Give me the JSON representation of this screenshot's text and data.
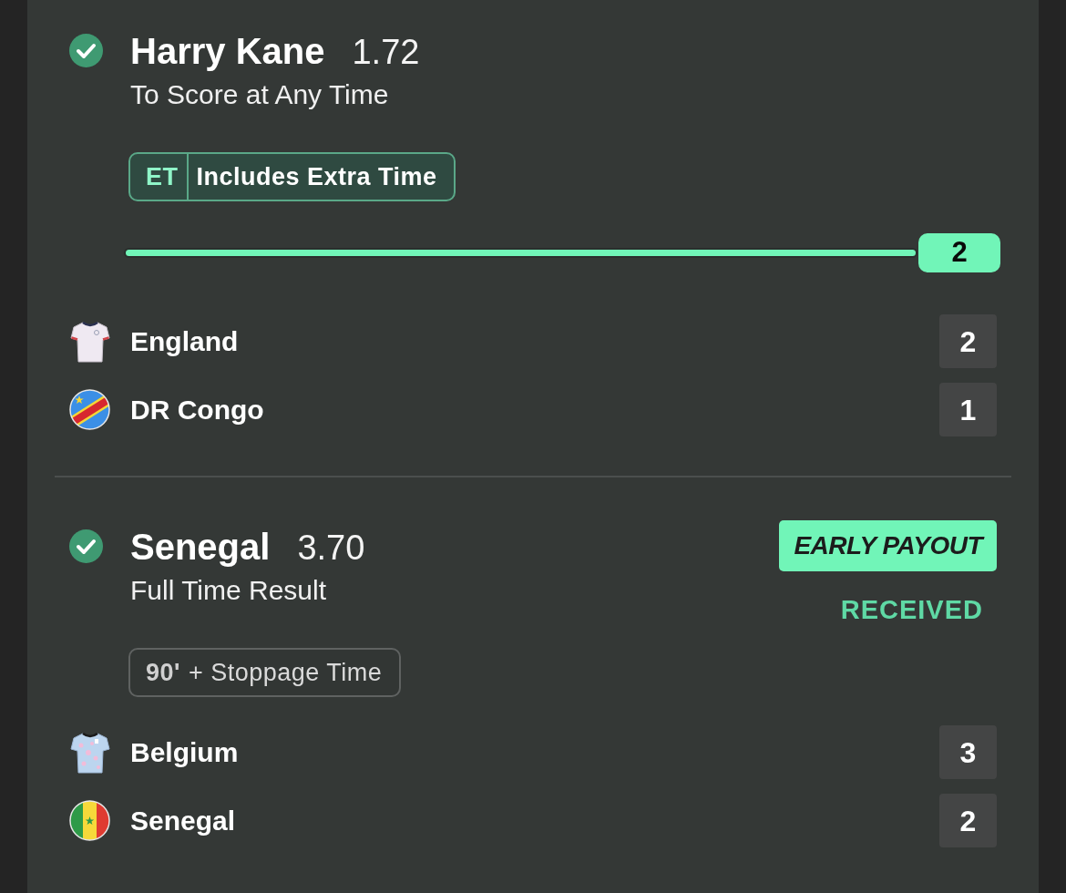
{
  "selections": [
    {
      "settled": true,
      "name": "Harry Kane",
      "odds": "1.72",
      "market": "To Score at Any Time",
      "time_badge": {
        "kind": "extra_time",
        "code": "ET",
        "label": "Includes Extra Time"
      },
      "progress": {
        "level": 1,
        "reading": "2"
      },
      "teams": [
        {
          "kind": "kit",
          "name": "England",
          "score": "2"
        },
        {
          "kind": "flag",
          "name": "DR Congo",
          "score": "1"
        }
      ]
    },
    {
      "settled": true,
      "name": "Senegal",
      "odds": "3.70",
      "market": "Full Time Result",
      "early_payout": {
        "label": "EARLY PAYOUT",
        "status": "RECEIVED"
      },
      "time_badge": {
        "kind": "regulation",
        "code": "90'",
        "label": "+ Stoppage Time"
      },
      "teams": [
        {
          "kind": "kit",
          "name": "Belgium",
          "score": "3"
        },
        {
          "kind": "flag",
          "name": "Senegal",
          "score": "2"
        }
      ]
    }
  ]
}
